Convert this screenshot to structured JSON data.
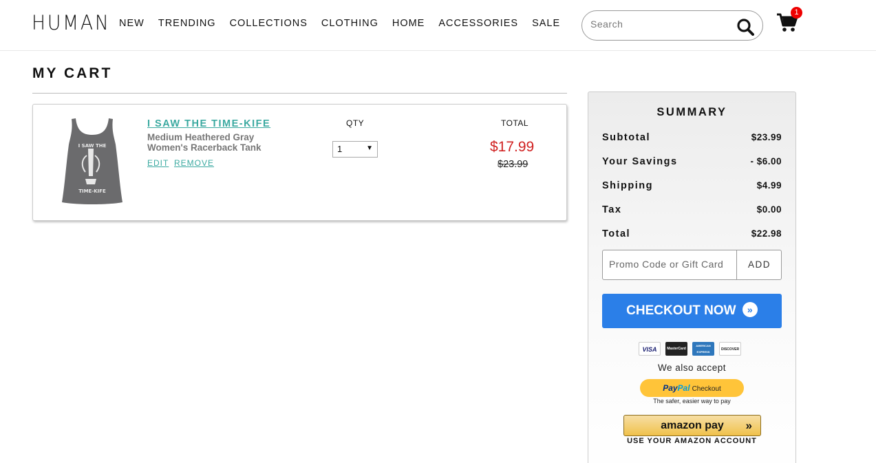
{
  "header": {
    "logo": "HUMAN",
    "nav": [
      "NEW",
      "TRENDING",
      "COLLECTIONS",
      "CLOTHING",
      "HOME",
      "ACCESSORIES",
      "SALE"
    ],
    "search_placeholder": "Search",
    "cart_count": "1"
  },
  "page": {
    "title": "MY CART"
  },
  "cart_item": {
    "name": "I SAW THE TIME-KIFE",
    "desc_line1": "Medium Heathered Gray",
    "desc_line2": "Women's Racerback Tank",
    "edit_label": "EDIT",
    "remove_label": "REMOVE",
    "qty_label": "QTY",
    "qty_value": "1",
    "total_label": "TOTAL",
    "price_now": "$17.99",
    "price_was": "$23.99"
  },
  "summary": {
    "title": "SUMMARY",
    "rows": [
      {
        "label": "Subtotal",
        "value": "$23.99"
      },
      {
        "label": "Your Savings",
        "value": "- $6.00"
      },
      {
        "label": "Shipping",
        "value": "$4.99"
      },
      {
        "label": "Tax",
        "value": "$0.00"
      },
      {
        "label": "Total",
        "value": "$22.98"
      }
    ],
    "promo_placeholder": "Promo Code or Gift Card",
    "add_label": "ADD",
    "checkout_label": "CHECKOUT NOW",
    "cards": [
      "VISA",
      "MasterCard",
      "AMERICAN EXPRESS",
      "DISCOVER"
    ],
    "also_accept": "We also accept",
    "paypal": {
      "pay": "Pay",
      "pal": "Pal",
      "checkout": "Checkout",
      "tagline": "The safer, easier way to pay"
    },
    "amazon": {
      "label": "amazon pay",
      "tagline": "USE YOUR AMAZON ACCOUNT"
    }
  },
  "colors": {
    "accent_teal": "#3aa9a0",
    "sale_red": "#d02020",
    "checkout_blue": "#2b7fe8",
    "paypal_yellow": "#ffc439",
    "badge_red": "#ee0000"
  }
}
